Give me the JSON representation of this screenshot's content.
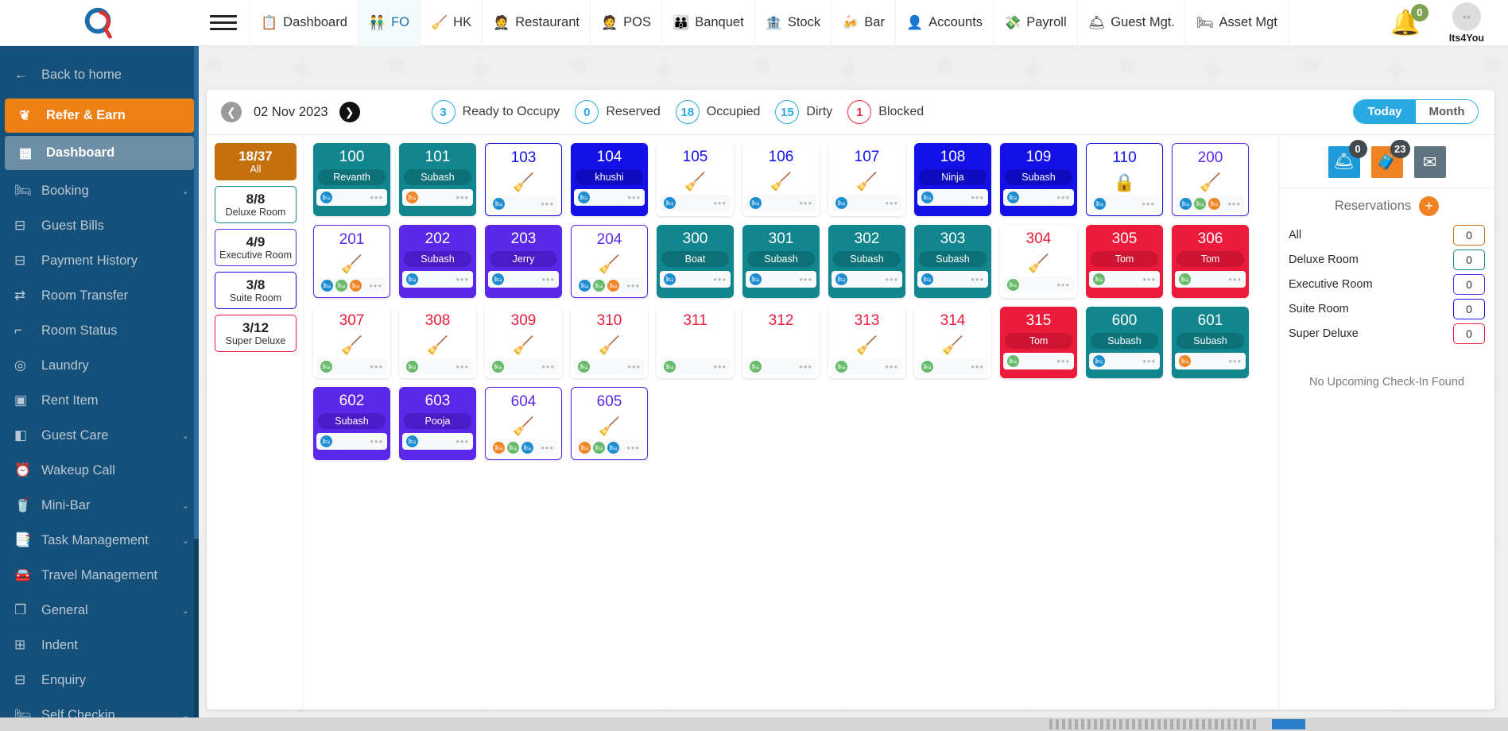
{
  "app": {
    "logo_name": "q-logo",
    "user_name": "Its4You",
    "bell_badge": "0"
  },
  "topnav": {
    "menu_icon": "hamburger-icon",
    "tabs": [
      {
        "label": "Dashboard",
        "icon": "dashboard-list-icon",
        "active": false
      },
      {
        "label": "FO",
        "icon": "front-office-people-icon",
        "active": true
      },
      {
        "label": "HK",
        "icon": "housekeeping-icon",
        "active": false
      },
      {
        "label": "Restaurant",
        "icon": "waiter-icon",
        "active": false
      },
      {
        "label": "POS",
        "icon": "pos-waiter-icon",
        "active": false
      },
      {
        "label": "Banquet",
        "icon": "banquet-people-icon",
        "active": false
      },
      {
        "label": "Stock",
        "icon": "warehouse-icon",
        "active": false
      },
      {
        "label": "Bar",
        "icon": "bar-table-icon",
        "active": false
      },
      {
        "label": "Accounts",
        "icon": "accounts-user-icon",
        "active": false
      },
      {
        "label": "Payroll",
        "icon": "payroll-hand-money-icon",
        "active": false
      },
      {
        "label": "Guest Mgt.",
        "icon": "guest-management-icon",
        "active": false
      },
      {
        "label": "Asset Mgt",
        "icon": "asset-furniture-icon",
        "active": false
      }
    ]
  },
  "sidebar": {
    "items": [
      {
        "label": "Back to home",
        "icon": "arrow-left-icon",
        "state": "back",
        "caret": false
      },
      {
        "label": "Refer & Earn",
        "icon": "share-icon",
        "state": "refer",
        "caret": false
      },
      {
        "label": "Dashboard",
        "icon": "grid-icon",
        "state": "dashboard",
        "caret": false
      },
      {
        "label": "Booking",
        "icon": "bed-icon",
        "state": "normal",
        "caret": true
      },
      {
        "label": "Guest Bills",
        "icon": "bill-icon",
        "state": "normal",
        "caret": false
      },
      {
        "label": "Payment History",
        "icon": "payment-icon",
        "state": "normal",
        "caret": false
      },
      {
        "label": "Room Transfer",
        "icon": "transfer-icon",
        "state": "normal",
        "caret": false
      },
      {
        "label": "Room Status",
        "icon": "room-status-icon",
        "state": "normal",
        "caret": false
      },
      {
        "label": "Laundry",
        "icon": "laundry-icon",
        "state": "normal",
        "caret": false
      },
      {
        "label": "Rent Item",
        "icon": "rent-item-icon",
        "state": "normal",
        "caret": false
      },
      {
        "label": "Guest Care",
        "icon": "guest-care-icon",
        "state": "normal",
        "caret": true
      },
      {
        "label": "Wakeup Call",
        "icon": "alarm-clock-icon",
        "state": "normal",
        "caret": false
      },
      {
        "label": "Mini-Bar",
        "icon": "mini-bar-icon",
        "state": "normal",
        "caret": true
      },
      {
        "label": "Task Management",
        "icon": "task-book-icon",
        "state": "normal",
        "caret": true
      },
      {
        "label": "Travel Management",
        "icon": "car-icon",
        "state": "normal",
        "caret": false
      },
      {
        "label": "General",
        "icon": "general-layers-icon",
        "state": "normal",
        "caret": true
      },
      {
        "label": "Indent",
        "icon": "indent-plus-icon",
        "state": "normal",
        "caret": false
      },
      {
        "label": "Enquiry",
        "icon": "enquiry-icon",
        "state": "normal",
        "caret": false
      },
      {
        "label": "Self Checkin",
        "icon": "self-checkin-bed-icon",
        "state": "normal",
        "caret": true
      }
    ]
  },
  "statusbar": {
    "date": "02 Nov 2023",
    "prev_icon": "chevron-left-icon",
    "next_icon": "chevron-right-icon",
    "chips": [
      {
        "count": "3",
        "label": "Ready to Occupy",
        "color": "#29a9e1"
      },
      {
        "count": "0",
        "label": "Reserved",
        "color": "#29a9e1"
      },
      {
        "count": "18",
        "label": "Occupied",
        "color": "#29a9e1"
      },
      {
        "count": "15",
        "label": "Dirty",
        "color": "#29a9e1"
      },
      {
        "count": "1",
        "label": "Blocked",
        "color": "#ef2b3f"
      }
    ],
    "view_today": "Today",
    "view_month": "Month",
    "view_selected": "Today"
  },
  "filters": [
    {
      "count": "18/37",
      "label": "All",
      "color": "#c4700f",
      "selected": true
    },
    {
      "count": "8/8",
      "label": "Deluxe Room",
      "color": "#12868f",
      "selected": false
    },
    {
      "count": "4/9",
      "label": "Executive Room",
      "color": "#5b27e8",
      "selected": false
    },
    {
      "count": "3/8",
      "label": "Suite Room",
      "color": "#1410e8",
      "selected": false
    },
    {
      "count": "3/12",
      "label": "Super Deluxe",
      "color": "#ed1b3b",
      "selected": false
    }
  ],
  "rooms": [
    {
      "number": "100",
      "guest": "Revanth",
      "status": "occupied",
      "type": "deluxe",
      "glyph": "",
      "dots": [
        "blue"
      ]
    },
    {
      "number": "101",
      "guest": "Subash",
      "status": "occupied",
      "type": "deluxe",
      "glyph": "",
      "dots": [
        "orange"
      ]
    },
    {
      "number": "103",
      "guest": "",
      "status": "dirty",
      "type": "suite",
      "glyph": "broom",
      "dots": [
        "blue"
      ]
    },
    {
      "number": "104",
      "guest": "khushi",
      "status": "occupied",
      "type": "suite",
      "glyph": "",
      "dots": [
        "blue"
      ]
    },
    {
      "number": "105",
      "guest": "",
      "status": "dirty",
      "type": "suite",
      "glyph": "broom",
      "dots": [
        "blue"
      ]
    },
    {
      "number": "106",
      "guest": "",
      "status": "dirty",
      "type": "suite",
      "glyph": "broom",
      "dots": [
        "blue"
      ]
    },
    {
      "number": "107",
      "guest": "",
      "status": "dirty",
      "type": "suite",
      "glyph": "broom",
      "dots": [
        "blue"
      ]
    },
    {
      "number": "108",
      "guest": "Ninja",
      "status": "occupied",
      "type": "suite",
      "glyph": "",
      "dots": [
        "blue"
      ]
    },
    {
      "number": "109",
      "guest": "Subash",
      "status": "occupied",
      "type": "suite",
      "glyph": "",
      "dots": [
        "blue"
      ]
    },
    {
      "number": "110",
      "guest": "",
      "status": "blocked",
      "type": "suite",
      "glyph": "lock",
      "dots": [
        "blue"
      ]
    },
    {
      "number": "200",
      "guest": "",
      "status": "dirty",
      "type": "executive",
      "glyph": "cleaner",
      "dots": [
        "blue",
        "green",
        "orange"
      ]
    },
    {
      "number": "201",
      "guest": "",
      "status": "dirty",
      "type": "executive",
      "glyph": "broom",
      "dots": [
        "blue",
        "green",
        "orange"
      ]
    },
    {
      "number": "202",
      "guest": "Subash",
      "status": "occupied",
      "type": "executive",
      "glyph": "",
      "dots": [
        "blue"
      ]
    },
    {
      "number": "203",
      "guest": "Jerry",
      "status": "occupied",
      "type": "executive",
      "glyph": "",
      "dots": [
        "blue"
      ]
    },
    {
      "number": "204",
      "guest": "",
      "status": "dirty",
      "type": "executive",
      "glyph": "broom",
      "dots": [
        "blue",
        "green",
        "orange"
      ]
    },
    {
      "number": "300",
      "guest": "Boat",
      "status": "occupied",
      "type": "deluxe",
      "glyph": "",
      "dots": [
        "blue"
      ]
    },
    {
      "number": "301",
      "guest": "Subash",
      "status": "occupied",
      "type": "deluxe",
      "glyph": "",
      "dots": [
        "blue"
      ]
    },
    {
      "number": "302",
      "guest": "Subash",
      "status": "occupied",
      "type": "deluxe",
      "glyph": "",
      "dots": [
        "blue"
      ]
    },
    {
      "number": "303",
      "guest": "Subash",
      "status": "occupied",
      "type": "deluxe",
      "glyph": "",
      "dots": [
        "blue"
      ]
    },
    {
      "number": "304",
      "guest": "",
      "status": "dirty",
      "type": "superdeluxe",
      "glyph": "broom",
      "dots": [
        "green"
      ]
    },
    {
      "number": "305",
      "guest": "Tom",
      "status": "occupied",
      "type": "superdeluxe",
      "glyph": "",
      "dots": [
        "green"
      ]
    },
    {
      "number": "306",
      "guest": "Tom",
      "status": "occupied",
      "type": "superdeluxe",
      "glyph": "",
      "dots": [
        "green"
      ]
    },
    {
      "number": "307",
      "guest": "",
      "status": "dirty",
      "type": "superdeluxe",
      "glyph": "broom",
      "dots": [
        "green"
      ]
    },
    {
      "number": "308",
      "guest": "",
      "status": "dirty",
      "type": "superdeluxe",
      "glyph": "broom",
      "dots": [
        "green"
      ]
    },
    {
      "number": "309",
      "guest": "",
      "status": "dirty",
      "type": "superdeluxe",
      "glyph": "broom",
      "dots": [
        "green"
      ]
    },
    {
      "number": "310",
      "guest": "",
      "status": "dirty",
      "type": "superdeluxe",
      "glyph": "broom",
      "dots": [
        "green"
      ]
    },
    {
      "number": "311",
      "guest": "",
      "status": "ready",
      "type": "superdeluxe",
      "glyph": "",
      "dots": [
        "green"
      ]
    },
    {
      "number": "312",
      "guest": "",
      "status": "ready",
      "type": "superdeluxe",
      "glyph": "",
      "dots": [
        "green"
      ]
    },
    {
      "number": "313",
      "guest": "",
      "status": "dirty",
      "type": "superdeluxe",
      "glyph": "broom",
      "dots": [
        "green"
      ]
    },
    {
      "number": "314",
      "guest": "",
      "status": "dirty",
      "type": "superdeluxe",
      "glyph": "broom",
      "dots": [
        "green"
      ]
    },
    {
      "number": "315",
      "guest": "Tom",
      "status": "occupied",
      "type": "superdeluxe",
      "glyph": "",
      "dots": [
        "green"
      ]
    },
    {
      "number": "600",
      "guest": "Subash",
      "status": "occupied",
      "type": "deluxe",
      "glyph": "",
      "dots": [
        "blue"
      ]
    },
    {
      "number": "601",
      "guest": "Subash",
      "status": "occupied",
      "type": "deluxe",
      "glyph": "",
      "dots": [
        "orange"
      ]
    },
    {
      "number": "602",
      "guest": "Subash",
      "status": "occupied",
      "type": "executive",
      "glyph": "",
      "dots": [
        "blue"
      ]
    },
    {
      "number": "603",
      "guest": "Pooja",
      "status": "occupied",
      "type": "executive",
      "glyph": "",
      "dots": [
        "blue"
      ]
    },
    {
      "number": "604",
      "guest": "",
      "status": "dirty",
      "type": "executive",
      "glyph": "broom",
      "dots": [
        "orange",
        "green",
        "blue"
      ]
    },
    {
      "number": "605",
      "guest": "",
      "status": "dirty",
      "type": "executive",
      "glyph": "broom",
      "dots": [
        "orange",
        "green",
        "blue"
      ]
    }
  ],
  "right_panel": {
    "icons": [
      {
        "name": "check-in-icon",
        "badge": "0",
        "color": "#1d9bd8"
      },
      {
        "name": "check-out-icon",
        "badge": "23",
        "color": "#ef8222"
      },
      {
        "name": "envelope-icon",
        "badge": "",
        "color": "#5f7480"
      }
    ],
    "title": "Reservations",
    "add_icon": "plus-icon",
    "rows": [
      {
        "label": "All",
        "count": "0",
        "color": "#c4700f"
      },
      {
        "label": "Deluxe Room",
        "count": "0",
        "color": "#12868f"
      },
      {
        "label": "Executive Room",
        "count": "0",
        "color": "#5b27e8"
      },
      {
        "label": "Suite Room",
        "count": "0",
        "color": "#1410e8"
      },
      {
        "label": "Super Deluxe",
        "count": "0",
        "color": "#ed1b3b"
      }
    ],
    "empty_text": "No Upcoming Check-In Found"
  }
}
